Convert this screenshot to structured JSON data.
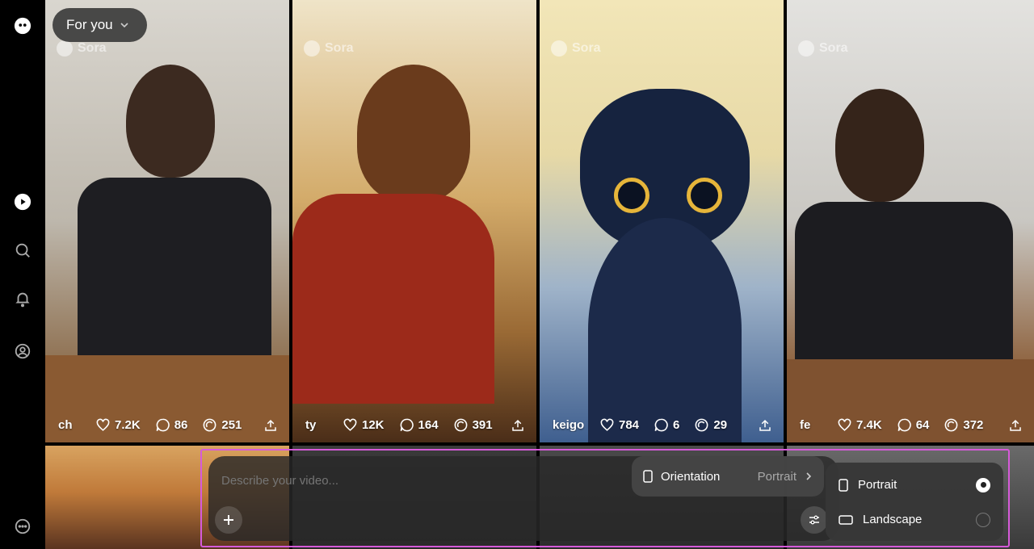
{
  "app": {
    "logo": "sora-logo-icon"
  },
  "sidebar": {
    "items": [
      {
        "name": "explore",
        "icon": "play-icon"
      },
      {
        "name": "search",
        "icon": "search-icon"
      },
      {
        "name": "notifications",
        "icon": "bell-icon"
      },
      {
        "name": "profile",
        "icon": "profile-icon"
      },
      {
        "name": "more",
        "icon": "more-icon"
      }
    ]
  },
  "feed": {
    "label": "For you"
  },
  "watermark": "Sora",
  "cards": [
    {
      "user": "ch",
      "likes": "7.2K",
      "comments": "86",
      "remixes": "251"
    },
    {
      "user": "ty",
      "likes": "12K",
      "comments": "164",
      "remixes": "391"
    },
    {
      "user": "keigo",
      "likes": "784",
      "comments": "6",
      "remixes": "29"
    },
    {
      "user": "fe",
      "likes": "7.4K",
      "comments": "64",
      "remixes": "372"
    }
  ],
  "composer": {
    "placeholder": "Describe your video...",
    "orientation_label": "Orientation",
    "orientation_value": "Portrait",
    "options": [
      "Portrait",
      "Landscape"
    ],
    "selected": "Portrait"
  },
  "colors": {
    "highlight": "#d65ad9",
    "background": "#000000"
  }
}
